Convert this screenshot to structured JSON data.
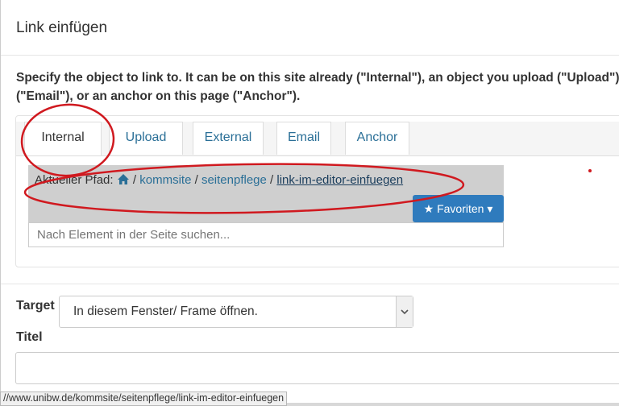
{
  "dialog": {
    "title": "Link einfügen",
    "instructions_line1": "Specify the object to link to. It can be on this site already (\"Internal\"), an object you upload (\"Upload\"), f",
    "instructions_line2": "(\"Email\"), or an anchor on this page (\"Anchor\")."
  },
  "tabs": [
    {
      "label": "Internal",
      "active": true
    },
    {
      "label": "Upload"
    },
    {
      "label": "External"
    },
    {
      "label": "Email"
    },
    {
      "label": "Anchor"
    }
  ],
  "path": {
    "label": "Aktueller Pfad:",
    "separator": "/",
    "segments": [
      "kommsite",
      "seitenpflege",
      "link-im-editor-einfuegen"
    ],
    "home_icon": "home-icon"
  },
  "favorites": {
    "label": "★ Favoriten ▾"
  },
  "search": {
    "placeholder": "Nach Element in der Seite suchen..."
  },
  "target": {
    "label": "Target",
    "selected": "In diesem Fenster/ Frame öffnen."
  },
  "titel": {
    "label": "Titel",
    "value": ""
  },
  "statusbar": {
    "url": "//www.unibw.de/kommsite/seitenpflege/link-im-editor-einfuegen"
  },
  "colors": {
    "link": "#2a6f97",
    "primary_button": "#2f7bbd",
    "annotation": "#d0191f"
  }
}
